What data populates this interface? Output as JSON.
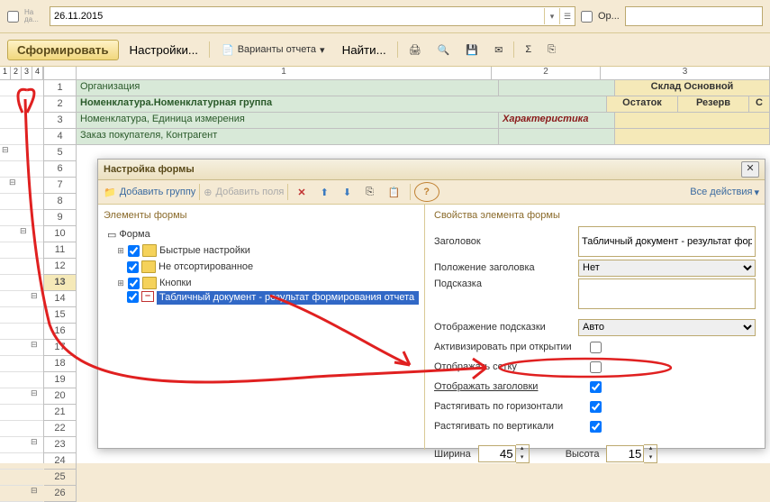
{
  "topbar": {
    "na_label": "На да...",
    "date": "26.11.2015",
    "or_label": "Ор..."
  },
  "toolbar": {
    "form_btn": "Сформировать",
    "settings": "Настройки...",
    "variants": "Варианты отчета",
    "find": "Найти..."
  },
  "outline_levels": [
    "1",
    "2",
    "3",
    "4"
  ],
  "columns": {
    "c1": "1",
    "c2": "2",
    "c3": "3"
  },
  "rows": {
    "r1": {
      "c1": "Организация",
      "c3": "Склад Основной"
    },
    "r2": {
      "c1": "Номенклатура.Номенклатурная группа",
      "c2a": "Остаток",
      "c2b": "Резерв",
      "c2c": "С"
    },
    "r3": {
      "c1": "Номенклатура, Единица измерения",
      "c2": "Характеристика"
    },
    "r4": {
      "c1": "Заказ покупателя, Контрагент"
    }
  },
  "row_numbers": [
    "1",
    "2",
    "3",
    "4",
    "5",
    "6",
    "7",
    "8",
    "9",
    "10",
    "11",
    "12",
    "13",
    "14",
    "15",
    "16",
    "17",
    "18",
    "19",
    "20",
    "21",
    "22",
    "23",
    "24",
    "25",
    "26"
  ],
  "dialog": {
    "title": "Настройка формы",
    "add_group": "Добавить группу",
    "add_fields": "Добавить поля",
    "all_actions": "Все действия",
    "left_header": "Элементы формы",
    "right_header": "Свойства элемента формы",
    "tree": {
      "root": "Форма",
      "quick": "Быстрые настройки",
      "unsorted": "Не отсортированное",
      "buttons": "Кнопки",
      "tabdoc": "Табличный документ - результат формирования отчета"
    },
    "props": {
      "header_lbl": "Заголовок",
      "header_val": "Табличный документ - результат формирования отчета",
      "pos_lbl": "Положение заголовка",
      "pos_val": "Нет",
      "hint_lbl": "Подсказка",
      "hint_val": "",
      "hint_disp_lbl": "Отображение подсказки",
      "hint_disp_val": "Авто",
      "activate_lbl": "Активизировать при открытии",
      "show_grid_lbl": "Отображать сетку",
      "show_headers_lbl": "Отображать заголовки",
      "stretch_h_lbl": "Растягивать по горизонтали",
      "stretch_v_lbl": "Растягивать по вертикали",
      "width_lbl": "Ширина",
      "width_val": "45",
      "height_lbl": "Высота",
      "height_val": "15"
    }
  }
}
